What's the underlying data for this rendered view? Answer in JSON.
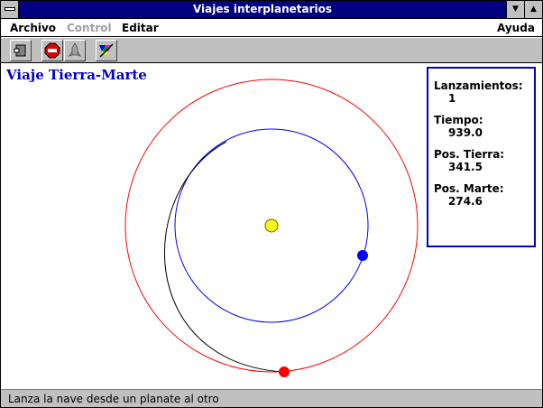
{
  "window": {
    "title": "Viajes interplanetarios"
  },
  "menu": {
    "archivo": "Archivo",
    "control": "Control",
    "editar": "Editar",
    "ayuda": "Ayuda"
  },
  "toolbar": {
    "buttons": [
      "exit-icon",
      "stop-icon",
      "rocket-icon",
      "prism-icon"
    ]
  },
  "canvas": {
    "trip_title": "Viaje Tierra-Marte",
    "colors": {
      "sun": "#ffff00",
      "earth": "#0000ff",
      "mars": "#ff0000",
      "earth_orbit": "#0000ff",
      "mars_orbit": "#ff0000",
      "trajectory": "#000000"
    }
  },
  "info": {
    "launches_label": "Lanzamientos:",
    "launches_value": "1",
    "time_label": "Tiempo:",
    "time_value": "939.0",
    "earth_pos_label": "Pos. Tierra:",
    "earth_pos_value": "341.5",
    "mars_pos_label": "Pos. Marte:",
    "mars_pos_value": "274.6"
  },
  "status": {
    "text": "Lanza la nave desde un planate al otro"
  }
}
